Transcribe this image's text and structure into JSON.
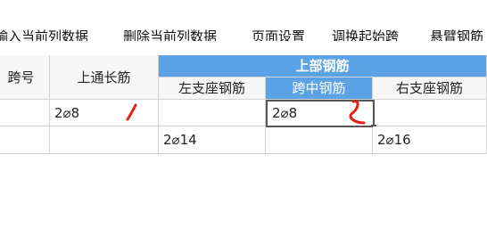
{
  "toolbar": {
    "items": [
      "输入当前列数据",
      "删除当前列数据",
      "页面设置",
      "调换起始跨",
      "悬臂钢筋"
    ]
  },
  "table": {
    "headers": {
      "span_no": "跨号",
      "top_through": "上通长筋",
      "top_group": "上部钢筋",
      "left_support": "左支座钢筋",
      "mid_span": "跨中钢筋",
      "right_support": "右支座钢筋"
    },
    "rows": [
      {
        "span_no": "",
        "top_through": "2⌀8",
        "left_support": "",
        "mid_span": "2⌀8",
        "right_support": ""
      },
      {
        "span_no": "",
        "top_through": "",
        "left_support": "2⌀14",
        "mid_span": "",
        "right_support": "2⌀16"
      }
    ]
  },
  "colors": {
    "header_accent": "#5ba3e6",
    "annotation": "#e0201c"
  }
}
